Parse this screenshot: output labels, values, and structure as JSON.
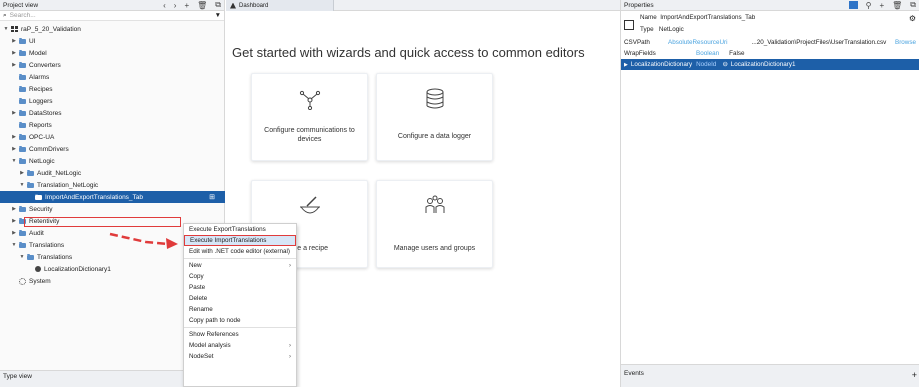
{
  "project_view": {
    "title": "Project view",
    "header_icons": [
      "‹",
      "›",
      "+",
      "🗑",
      "⧉"
    ],
    "search_placeholder": "Search...",
    "tree": [
      {
        "label": "raP_5_20_Validation",
        "depth": 0,
        "arrow": "▼",
        "icon": "grid"
      },
      {
        "label": "UI",
        "depth": 1,
        "arrow": "▶",
        "icon": "folder"
      },
      {
        "label": "Model",
        "depth": 1,
        "arrow": "▶",
        "icon": "folder"
      },
      {
        "label": "Converters",
        "depth": 1,
        "arrow": "▶",
        "icon": "folder"
      },
      {
        "label": "Alarms",
        "depth": 1,
        "arrow": "",
        "icon": "folder"
      },
      {
        "label": "Recipes",
        "depth": 1,
        "arrow": "",
        "icon": "folder"
      },
      {
        "label": "Loggers",
        "depth": 1,
        "arrow": "",
        "icon": "folder"
      },
      {
        "label": "DataStores",
        "depth": 1,
        "arrow": "▶",
        "icon": "folder"
      },
      {
        "label": "Reports",
        "depth": 1,
        "arrow": "",
        "icon": "folder"
      },
      {
        "label": "OPC-UA",
        "depth": 1,
        "arrow": "▶",
        "icon": "folder"
      },
      {
        "label": "CommDrivers",
        "depth": 1,
        "arrow": "▶",
        "icon": "folder"
      },
      {
        "label": "NetLogic",
        "depth": 1,
        "arrow": "▼",
        "icon": "folder"
      },
      {
        "label": "Audit_NetLogic",
        "depth": 2,
        "arrow": "▶",
        "icon": "folder"
      },
      {
        "label": "Translation_NetLogic",
        "depth": 2,
        "arrow": "▼",
        "icon": "folder"
      },
      {
        "label": "ImportAndExportTranslations_Tab",
        "depth": 3,
        "arrow": "",
        "icon": "netlogic",
        "selected": true
      },
      {
        "label": "Security",
        "depth": 1,
        "arrow": "▶",
        "icon": "folder"
      },
      {
        "label": "Retentivity",
        "depth": 1,
        "arrow": "▶",
        "icon": "folder"
      },
      {
        "label": "Audit",
        "depth": 1,
        "arrow": "▶",
        "icon": "folder"
      },
      {
        "label": "Translations",
        "depth": 1,
        "arrow": "▼",
        "icon": "folder"
      },
      {
        "label": "Translations",
        "depth": 2,
        "arrow": "▼",
        "icon": "folder"
      },
      {
        "label": "LocalizationDictionary1",
        "depth": 3,
        "arrow": "",
        "icon": "globe"
      },
      {
        "label": "System",
        "depth": 1,
        "arrow": "",
        "icon": "gear"
      }
    ],
    "type_view_label": "Type view"
  },
  "dashboard": {
    "tab_label": "Dashboard",
    "heading": "Get started with wizards and quick access to common editors",
    "cards": [
      {
        "label": "Configure communications to devices",
        "icon": "network"
      },
      {
        "label": "Configure a data logger",
        "icon": "database"
      },
      {
        "label": "ure a recipe",
        "icon": "recipe"
      },
      {
        "label": "Manage users and groups",
        "icon": "users"
      }
    ]
  },
  "context_menu": {
    "items": [
      {
        "label": "Execute ExportTranslations"
      },
      {
        "label": "Execute ImportTranslations",
        "highlighted": true
      },
      {
        "label": "Edit with .NET code editor (external)"
      },
      {
        "label": "New",
        "submenu": true
      },
      {
        "label": "Copy"
      },
      {
        "label": "Paste"
      },
      {
        "label": "Delete"
      },
      {
        "label": "Rename"
      },
      {
        "label": "Copy path to node"
      },
      {
        "label": "Show References"
      },
      {
        "label": "Model analysis",
        "submenu": true
      },
      {
        "label": "NodeSet",
        "submenu": true
      }
    ]
  },
  "properties": {
    "title": "Properties",
    "name_label": "Name",
    "name_value": "ImportAndExportTranslations_Tab",
    "type_label": "Type",
    "type_value": "NetLogic",
    "rows": [
      {
        "key": "CSVPath",
        "type": "AbsoluteResourceUri",
        "value": "...20_Validation\\ProjectFiles\\UserTranslation.csv",
        "action": "Browse"
      },
      {
        "key": "WrapFields",
        "type": "Boolean",
        "value": "False"
      },
      {
        "key": "LocalizationDictionary",
        "type": "NodeId",
        "value": "LocalizationDictionary1",
        "selected": true
      }
    ],
    "events_label": "Events",
    "events_add": "+"
  },
  "colors": {
    "selection_blue": "#1d5fa8",
    "annotation_red": "#e03b3b",
    "type_blue": "#4aa3df"
  }
}
